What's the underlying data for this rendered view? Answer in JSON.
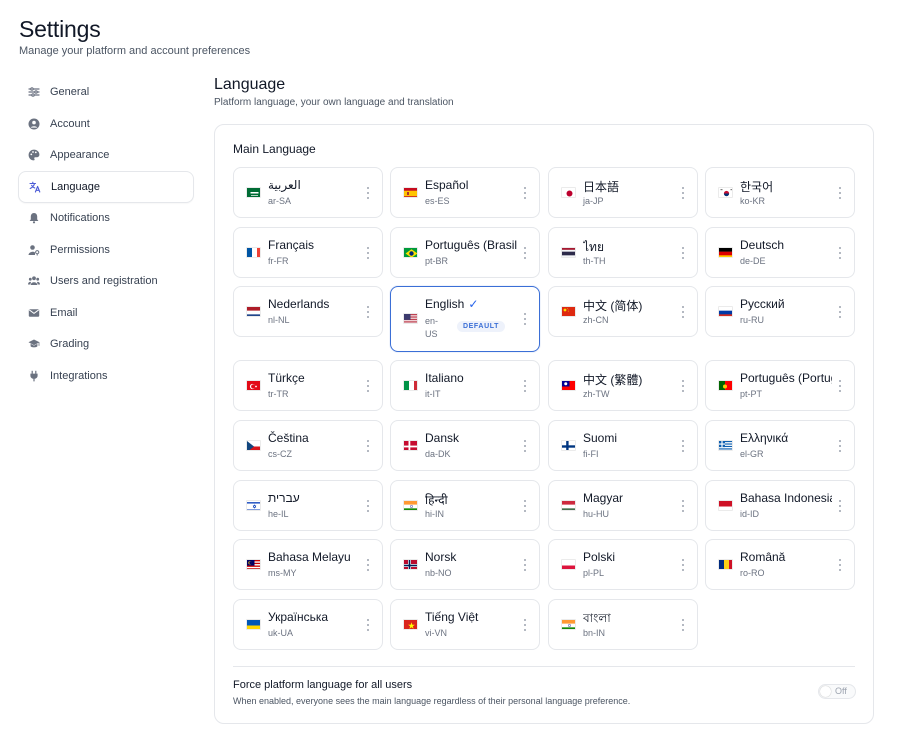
{
  "header": {
    "title": "Settings",
    "subtitle": "Manage your platform and account preferences"
  },
  "sidebar": {
    "items": [
      {
        "label": "General",
        "icon": "sliders-icon"
      },
      {
        "label": "Account",
        "icon": "user-circle-icon"
      },
      {
        "label": "Appearance",
        "icon": "palette-icon"
      },
      {
        "label": "Language",
        "icon": "translate-icon",
        "active": true
      },
      {
        "label": "Notifications",
        "icon": "bell-icon"
      },
      {
        "label": "Permissions",
        "icon": "user-key-icon"
      },
      {
        "label": "Users and registration",
        "icon": "users-icon"
      },
      {
        "label": "Email",
        "icon": "mail-icon"
      },
      {
        "label": "Grading",
        "icon": "graduation-cap-icon"
      },
      {
        "label": "Integrations",
        "icon": "plug-icon"
      }
    ]
  },
  "section": {
    "title": "Language",
    "subtitle": "Platform language, your own language and translation"
  },
  "main_language": {
    "heading": "Main Language",
    "default_badge": "DEFAULT",
    "languages": [
      {
        "name": "العربية",
        "code": "ar-SA",
        "flag": "sa"
      },
      {
        "name": "Español",
        "code": "es-ES",
        "flag": "es"
      },
      {
        "name": "日本語",
        "code": "ja-JP",
        "flag": "jp"
      },
      {
        "name": "한국어",
        "code": "ko-KR",
        "flag": "kr"
      },
      {
        "name": "Français",
        "code": "fr-FR",
        "flag": "fr"
      },
      {
        "name": "Português (Brasil)",
        "code": "pt-BR",
        "flag": "br"
      },
      {
        "name": "ไทย",
        "code": "th-TH",
        "flag": "th"
      },
      {
        "name": "Deutsch",
        "code": "de-DE",
        "flag": "de"
      },
      {
        "name": "Nederlands",
        "code": "nl-NL",
        "flag": "nl"
      },
      {
        "name": "English",
        "code": "en-US",
        "flag": "us",
        "selected": true
      },
      {
        "name": "中文 (简体)",
        "code": "zh-CN",
        "flag": "cn"
      },
      {
        "name": "Русский",
        "code": "ru-RU",
        "flag": "ru"
      },
      {
        "name": "Türkçe",
        "code": "tr-TR",
        "flag": "tr"
      },
      {
        "name": "Italiano",
        "code": "it-IT",
        "flag": "it"
      },
      {
        "name": "中文 (繁體)",
        "code": "zh-TW",
        "flag": "tw"
      },
      {
        "name": "Português (Portugal)",
        "code": "pt-PT",
        "flag": "pt"
      },
      {
        "name": "Čeština",
        "code": "cs-CZ",
        "flag": "cz"
      },
      {
        "name": "Dansk",
        "code": "da-DK",
        "flag": "dk"
      },
      {
        "name": "Suomi",
        "code": "fi-FI",
        "flag": "fi"
      },
      {
        "name": "Ελληνικά",
        "code": "el-GR",
        "flag": "gr"
      },
      {
        "name": "עברית",
        "code": "he-IL",
        "flag": "il"
      },
      {
        "name": "हिन्दी",
        "code": "hi-IN",
        "flag": "in"
      },
      {
        "name": "Magyar",
        "code": "hu-HU",
        "flag": "hu"
      },
      {
        "name": "Bahasa Indonesia",
        "code": "id-ID",
        "flag": "id"
      },
      {
        "name": "Bahasa Melayu",
        "code": "ms-MY",
        "flag": "my"
      },
      {
        "name": "Norsk",
        "code": "nb-NO",
        "flag": "no"
      },
      {
        "name": "Polski",
        "code": "pl-PL",
        "flag": "pl"
      },
      {
        "name": "Română",
        "code": "ro-RO",
        "flag": "ro"
      },
      {
        "name": "Українська",
        "code": "uk-UA",
        "flag": "ua"
      },
      {
        "name": "Tiếng Việt",
        "code": "vi-VN",
        "flag": "vn"
      },
      {
        "name": "বাংলা",
        "code": "bn-IN",
        "flag": "in"
      }
    ]
  },
  "force_language": {
    "title": "Force platform language for all users",
    "description": "When enabled, everyone sees the main language regardless of their personal language preference.",
    "toggle_label": "Off",
    "enabled": false
  },
  "colors": {
    "accent": "#3b6fd6",
    "border": "#e5e7eb",
    "text": "#111827",
    "muted": "#6b7280"
  }
}
